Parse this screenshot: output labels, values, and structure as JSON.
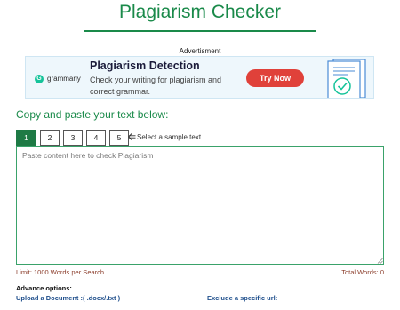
{
  "header": {
    "title": "Plagiarism Checker"
  },
  "ad": {
    "caption": "Advertisment",
    "brand": "grammarly",
    "brand_logo_letter": "G",
    "headline": "Plagiarism Detection",
    "body": "Check your writing for plagiarism and correct grammar.",
    "cta_label": "Try Now",
    "cta_color": "#e0413a"
  },
  "checker": {
    "heading": "Copy and paste your text below:",
    "sample_tabs": [
      "1",
      "2",
      "3",
      "4",
      "5"
    ],
    "active_tab": "1",
    "sample_hint": "Select a sample text",
    "placeholder": "Paste content here to check Plagiarism",
    "limit": "Limit: 1000 Words per Search",
    "total_words": "Total Words: 0"
  },
  "options": {
    "label": "Advance options:",
    "upload_link": "Upload a Document :( .docx/.txt )",
    "exclude_link": "Exclude a specific url:"
  },
  "colors": {
    "accent": "#1a8a4a",
    "active_tab": "#1e7a45",
    "link": "#1f4f8c",
    "limit_text": "#8b3d2b"
  }
}
